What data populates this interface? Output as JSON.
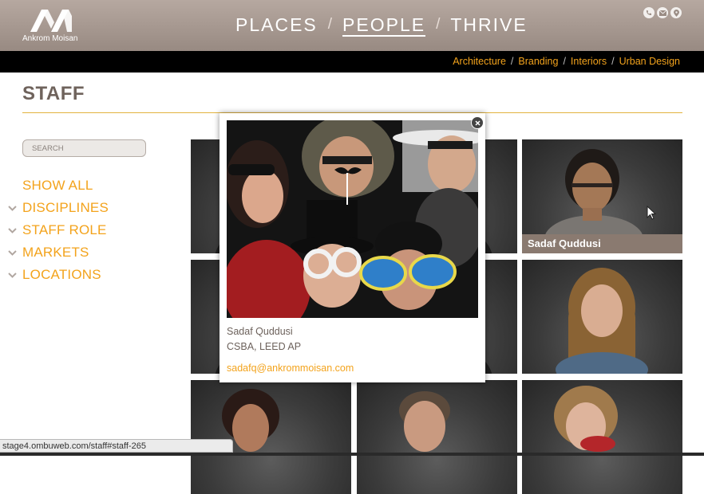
{
  "brand": {
    "name": "Ankrom Moisan"
  },
  "main_nav": {
    "items": [
      {
        "label": "PLACES",
        "active": false
      },
      {
        "label": "PEOPLE",
        "active": true
      },
      {
        "label": "THRIVE",
        "active": false
      }
    ],
    "separator": "/"
  },
  "social_icons": [
    "phone-icon",
    "mail-icon",
    "location-pin-icon"
  ],
  "sub_nav": {
    "items": [
      "Architecture",
      "Branding",
      "Interiors",
      "Urban Design"
    ],
    "separator": "/"
  },
  "page": {
    "title": "STAFF"
  },
  "sidebar": {
    "search_placeholder": "SEARCH",
    "filters": [
      {
        "label": "SHOW ALL",
        "expandable": false
      },
      {
        "label": "DISCIPLINES",
        "expandable": true
      },
      {
        "label": "STAFF ROLE",
        "expandable": true
      },
      {
        "label": "MARKETS",
        "expandable": true
      },
      {
        "label": "LOCATIONS",
        "expandable": true
      }
    ]
  },
  "staff_grid": {
    "highlighted": {
      "name": "Sadaf Quddusi"
    }
  },
  "popup": {
    "name": "Sadaf Quddusi",
    "credentials": "CSBA, LEED AP",
    "email": "sadafq@ankrommoisan.com"
  },
  "status_bar": {
    "url": "stage4.ombuweb.com/staff#staff-265"
  },
  "colors": {
    "accent": "#f3a31c",
    "header_bg": "#a89a92",
    "subnav_bg": "#000000",
    "name_bar": "#8a7a70",
    "title_text": "#6f635c"
  }
}
